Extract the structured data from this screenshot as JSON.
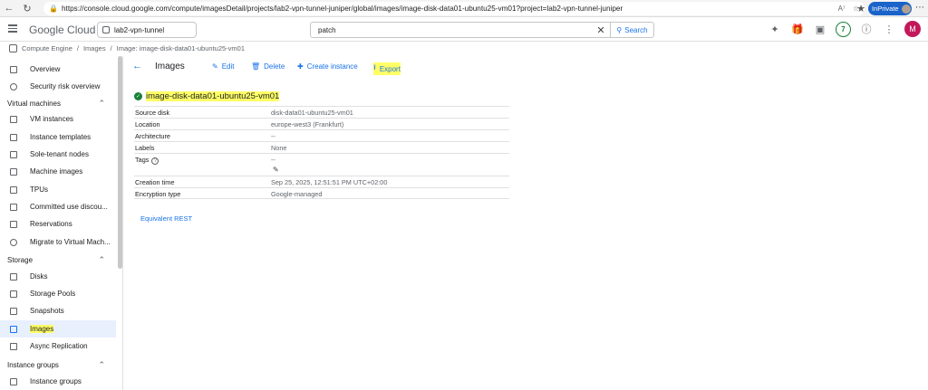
{
  "browser": {
    "url": "https://console.cloud.google.com/compute/imagesDetail/projects/lab2-vpn-tunnel-juniper/global/images/image-disk-data01-ubuntu25-vm01?project=lab2-vpn-tunnel-juniper",
    "profile_label": "InPrivate"
  },
  "topbar": {
    "logo_google": "Google",
    "logo_cloud": "Cloud",
    "project": "lab2-vpn-tunnel",
    "search_value": "patch",
    "search_button": "Search",
    "notification_count": "7",
    "avatar_initial": "M",
    "avatar_color": "#c2185b"
  },
  "breadcrumb": {
    "items": [
      "Compute Engine",
      "/",
      "Images",
      "/",
      "Image: image-disk-data01-ubuntu25-vm01"
    ]
  },
  "sidebar": {
    "top_items": [
      {
        "label": "Overview"
      },
      {
        "label": "Security risk overview"
      }
    ],
    "sections": [
      {
        "title": "Virtual machines",
        "items": [
          {
            "label": "VM instances"
          },
          {
            "label": "Instance templates"
          },
          {
            "label": "Sole-tenant nodes"
          },
          {
            "label": "Machine images"
          },
          {
            "label": "TPUs"
          },
          {
            "label": "Committed use discou..."
          },
          {
            "label": "Reservations"
          },
          {
            "label": "Migrate to Virtual Mach..."
          }
        ]
      },
      {
        "title": "Storage",
        "items": [
          {
            "label": "Disks"
          },
          {
            "label": "Storage Pools"
          },
          {
            "label": "Snapshots"
          },
          {
            "label": "Images",
            "active": true
          },
          {
            "label": "Async Replication"
          }
        ]
      },
      {
        "title": "Instance groups",
        "items": [
          {
            "label": "Instance groups"
          }
        ]
      }
    ]
  },
  "main": {
    "page_title": "Images",
    "actions": {
      "edit": "Edit",
      "delete": "Delete",
      "create_instance": "Create instance",
      "export": "Export"
    },
    "image_name": "image-disk-data01-ubuntu25-vm01",
    "details": [
      {
        "key": "Source disk",
        "value": "disk-data01-ubuntu25-vm01"
      },
      {
        "key": "Location",
        "value": "europe-west3 (Frankfurt)"
      },
      {
        "key": "Architecture",
        "value": "--"
      },
      {
        "key": "Labels",
        "value": "None"
      },
      {
        "key": "Tags",
        "value": "--"
      },
      {
        "key": "Creation time",
        "value": "Sep 25, 2025, 12:51:51 PM UTC+02:00"
      },
      {
        "key": "Encryption type",
        "value": "Google-managed"
      }
    ],
    "equivalent_rest": "Equivalent REST"
  },
  "colors": {
    "accent": "#1a73e8",
    "highlight": "#ffff66",
    "success": "#188038"
  }
}
